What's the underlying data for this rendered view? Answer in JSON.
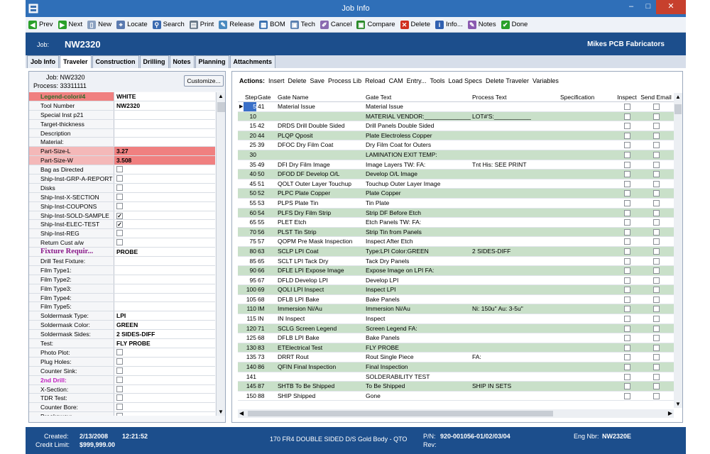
{
  "window": {
    "title": "Job Info",
    "minimize": "–",
    "maximize": "□",
    "close": "✕"
  },
  "toolbar": [
    {
      "label": "Prev",
      "icon": "prev-arrow-icon",
      "color": "#2aa02a",
      "glyph": "◀"
    },
    {
      "label": "Next",
      "icon": "next-arrow-icon",
      "color": "#2aa02a",
      "glyph": "▶"
    },
    {
      "label": "New",
      "icon": "new-document-icon",
      "color": "#8aa0c0",
      "glyph": "▯"
    },
    {
      "label": "Locate",
      "icon": "locate-icon",
      "color": "#5a7ab0",
      "glyph": "⌖"
    },
    {
      "label": "Search",
      "icon": "search-icon",
      "color": "#3a6ab0",
      "glyph": "⚲"
    },
    {
      "label": "Print",
      "icon": "printer-icon",
      "color": "#6a7a8a",
      "glyph": "▤"
    },
    {
      "label": "Release",
      "icon": "release-icon",
      "color": "#4a8ac0",
      "glyph": "✎"
    },
    {
      "label": "BOM",
      "icon": "bom-icon",
      "color": "#3a70b0",
      "glyph": "▦"
    },
    {
      "label": "Tech",
      "icon": "tech-icon",
      "color": "#5a80b0",
      "glyph": "▣"
    },
    {
      "label": "Cancel",
      "icon": "cancel-icon",
      "color": "#8a6ab0",
      "glyph": "✐"
    },
    {
      "label": "Compare",
      "icon": "compare-icon",
      "color": "#2a8a2a",
      "glyph": "▣"
    },
    {
      "label": "Delete",
      "icon": "delete-icon",
      "color": "#d03020",
      "glyph": "✕"
    },
    {
      "label": "Info...",
      "icon": "info-icon",
      "color": "#3060b0",
      "glyph": "i"
    },
    {
      "label": "Notes",
      "icon": "notes-icon",
      "color": "#8a5ab0",
      "glyph": "✎"
    },
    {
      "label": "Done",
      "icon": "done-check-icon",
      "color": "#2aa02a",
      "glyph": "✔"
    }
  ],
  "header": {
    "job_label": "Job:",
    "job_value": "NW2320",
    "company": "Mikes PCB Fabricators"
  },
  "tabs": [
    {
      "label": "Job Info",
      "active": false
    },
    {
      "label": "Traveler",
      "active": true
    },
    {
      "label": "Construction",
      "active": false
    },
    {
      "label": "Drilling",
      "active": false
    },
    {
      "label": "Notes",
      "active": false
    },
    {
      "label": "Planning",
      "active": false
    },
    {
      "label": "Attachments",
      "active": false
    }
  ],
  "left": {
    "job_line": "Job: NW2320",
    "process_line": "Process: 33311111",
    "customize": "Customize...",
    "rows": [
      {
        "key": "Legend-color#4",
        "value": "WHITE",
        "keyBg": "#f08080",
        "keyColor": "#2a6a2a",
        "bold": true
      },
      {
        "key": "Tool Number",
        "value": "NW2320"
      },
      {
        "key": "Special Inst p21",
        "value": ""
      },
      {
        "key": "Target-thickness",
        "value": ""
      },
      {
        "key": "Description",
        "value": ""
      },
      {
        "key": "Material:",
        "value": ""
      },
      {
        "key": "Part-Size-L",
        "value": "3.27",
        "keyBg": "#f4b8b8",
        "valBg": "#f08080"
      },
      {
        "key": "Part-Size-W",
        "value": "3.508",
        "keyBg": "#f4b8b8",
        "valBg": "#f08080"
      },
      {
        "key": "Bag as Directed",
        "check": false
      },
      {
        "key": "Ship-Inst-GRP-A-REPORT",
        "check": false
      },
      {
        "key": "Disks",
        "check": false
      },
      {
        "key": "Ship-Inst-X-SECTION",
        "check": false
      },
      {
        "key": "Ship-Inst-COUPONS",
        "check": false
      },
      {
        "key": "Ship-Inst-SOLD-SAMPLE",
        "check": true
      },
      {
        "key": "Ship-Inst-ELEC-TEST",
        "check": true
      },
      {
        "key": "Ship-Inst-REG",
        "check": false
      },
      {
        "key": "Return Cust a/w",
        "check": false
      },
      {
        "key": "Fixture Requir...",
        "value": "PROBE",
        "keyColor": "#8a1a8a",
        "big": true
      },
      {
        "key": "Drill Test Fixture:",
        "value": ""
      },
      {
        "key": "Film Type1:",
        "value": ""
      },
      {
        "key": "Film Type2:",
        "value": ""
      },
      {
        "key": "Film Type3:",
        "value": ""
      },
      {
        "key": "Film Type4:",
        "value": ""
      },
      {
        "key": "Film Type5:",
        "value": ""
      },
      {
        "key": "Soldermask Type:",
        "value": "LPI"
      },
      {
        "key": "Soldermask Color:",
        "value": "GREEN"
      },
      {
        "key": "Soldermask Sides:",
        "value": "2 SIDES-DIFF"
      },
      {
        "key": "Test:",
        "value": "FLY PROBE"
      },
      {
        "key": "Photo Plot:",
        "check": false
      },
      {
        "key": "Plug Holes:",
        "check": false
      },
      {
        "key": "Counter Sink:",
        "check": false
      },
      {
        "key": "2nd Drill:",
        "check": false,
        "keyColor": "#c020c0",
        "bold": true
      },
      {
        "key": "X-Section:",
        "check": false
      },
      {
        "key": "TDR Test:",
        "check": false
      },
      {
        "key": "Counter Bore:",
        "check": false
      },
      {
        "key": "Breakaway:",
        "check": false
      }
    ]
  },
  "actions": [
    "Actions:",
    "Insert",
    "Delete",
    "Save",
    "Process Lib",
    "Reload",
    "CAM",
    "Entry...",
    "Tools",
    "Load Specs",
    "Delete Traveler",
    "Variables"
  ],
  "table": {
    "headers": [
      "",
      "Step",
      "Gate",
      "Gate Name",
      "Gate Text",
      "Process Text",
      "Specification",
      "Inspect",
      "Send Email"
    ],
    "rows": [
      {
        "step": "5",
        "gate": "41",
        "name": "Material Issue",
        "text": "Material Issue",
        "proc": "",
        "spec": "",
        "g": false,
        "cur": true
      },
      {
        "step": "10",
        "gate": "",
        "name": "",
        "text": "MATERIAL VENDOR:_______________",
        "proc": "LOT#'S:___________",
        "spec": "",
        "g": true
      },
      {
        "step": "15",
        "gate": "42",
        "name": "DRDS Drill Double Sided",
        "text": "Drill Panels Double Sided",
        "proc": "",
        "spec": "",
        "g": false
      },
      {
        "step": "20",
        "gate": "44",
        "name": "PLQP Qposit",
        "text": "Plate Electroless Copper",
        "proc": "",
        "spec": "",
        "g": true
      },
      {
        "step": "25",
        "gate": "39",
        "name": "DFOC Dry Film Coat",
        "text": "Dry Film Coat for Outers",
        "proc": "",
        "spec": "",
        "g": false
      },
      {
        "step": "30",
        "gate": "",
        "name": "",
        "text": "LAMINATION EXIT TEMP:",
        "proc": "",
        "spec": "",
        "g": true
      },
      {
        "step": "35",
        "gate": "49",
        "name": "DFI Dry Film Image",
        "text": "Image Layers TW:      FA:",
        "proc": "Tnt His: SEE PRINT",
        "spec": "",
        "g": false
      },
      {
        "step": "40",
        "gate": "50",
        "name": "DFOD DF Develop O/L",
        "text": "Develop O/L Image",
        "proc": "",
        "spec": "",
        "g": true
      },
      {
        "step": "45",
        "gate": "51",
        "name": "QOLT Outer Layer Touchup",
        "text": "Touchup Outer Layer Image",
        "proc": "",
        "spec": "",
        "g": false
      },
      {
        "step": "50",
        "gate": "52",
        "name": "PLPC Plate Copper",
        "text": "Plate Copper",
        "proc": "",
        "spec": "",
        "g": true
      },
      {
        "step": "55",
        "gate": "53",
        "name": "PLPS Plate Tin",
        "text": "Tin Plate",
        "proc": "",
        "spec": "",
        "g": false
      },
      {
        "step": "60",
        "gate": "54",
        "name": "PLFS Dry Film Strip",
        "text": "Strip DF Before Etch",
        "proc": "",
        "spec": "",
        "g": true
      },
      {
        "step": "65",
        "gate": "55",
        "name": "PLET Etch",
        "text": "Etch Panels TW:      FA:",
        "proc": "",
        "spec": "",
        "g": false
      },
      {
        "step": "70",
        "gate": "56",
        "name": "PLST Tin Strip",
        "text": "Strip Tin from Panels",
        "proc": "",
        "spec": "",
        "g": true
      },
      {
        "step": "75",
        "gate": "57",
        "name": "QOPM Pre Mask Inspection",
        "text": "Inspect After Etch",
        "proc": "",
        "spec": "",
        "g": false
      },
      {
        "step": "80",
        "gate": "63",
        "name": "SCLP LPI Coat",
        "text": "Type:LPI Color:GREEN",
        "proc": "2 SIDES-DIFF",
        "spec": "",
        "g": true
      },
      {
        "step": "85",
        "gate": "65",
        "name": "SCLT LPI Tack Dry",
        "text": "Tack Dry Panels",
        "proc": "",
        "spec": "",
        "g": false
      },
      {
        "step": "90",
        "gate": "66",
        "name": "DFLE LPI Expose Image",
        "text": "Expose Image on LPI      FA:",
        "proc": "",
        "spec": "",
        "g": true
      },
      {
        "step": "95",
        "gate": "67",
        "name": "DFLD Develop LPI",
        "text": "Develop LPI",
        "proc": "",
        "spec": "",
        "g": false
      },
      {
        "step": "100",
        "gate": "69",
        "name": "QOLI LPI Inspect",
        "text": "Inspect LPI",
        "proc": "",
        "spec": "",
        "g": true
      },
      {
        "step": "105",
        "gate": "68",
        "name": "DFLB LPI Bake",
        "text": "Bake Panels",
        "proc": "",
        "spec": "",
        "g": false
      },
      {
        "step": "110",
        "gate": "IM",
        "name": "Immersion Ni/Au",
        "text": "Immersion Ni/Au",
        "proc": "Ni: 150u\"   Au: 3-5u\"",
        "spec": "",
        "g": true
      },
      {
        "step": "115",
        "gate": "IN",
        "name": "IN Inspect",
        "text": "Inspect",
        "proc": "",
        "spec": "",
        "g": false
      },
      {
        "step": "120",
        "gate": "71",
        "name": "SCLG Screen Legend",
        "text": "Screen Legend          FA:",
        "proc": "",
        "spec": "",
        "g": true
      },
      {
        "step": "125",
        "gate": "68",
        "name": "DFLB LPI Bake",
        "text": "Bake Panels",
        "proc": "",
        "spec": "",
        "g": false
      },
      {
        "step": "130",
        "gate": "83",
        "name": "ETElectrical Test",
        "text": "FLY PROBE",
        "proc": "",
        "spec": "",
        "g": true
      },
      {
        "step": "135",
        "gate": "73",
        "name": "DRRT Rout",
        "text": "Rout Single Piece",
        "proc": "FA:",
        "spec": "",
        "g": false
      },
      {
        "step": "140",
        "gate": "86",
        "name": "QFIN Final Inspection",
        "text": "Final Inspection",
        "proc": "",
        "spec": "",
        "g": true
      },
      {
        "step": "141",
        "gate": "",
        "name": "",
        "text": "SOLDERABILITY TEST",
        "proc": "",
        "spec": "",
        "g": false
      },
      {
        "step": "145",
        "gate": "87",
        "name": "SHTB To Be Shipped",
        "text": "To Be Shipped",
        "proc": "SHIP IN SETS",
        "spec": "",
        "g": true
      },
      {
        "step": "150",
        "gate": "88",
        "name": "SHIP Shipped",
        "text": "Gone",
        "proc": "",
        "spec": "",
        "g": false
      }
    ]
  },
  "footer": {
    "created_label": "Created:",
    "created_date": "2/13/2008",
    "created_time": "12:21:52",
    "credit_label": "Credit Limit:",
    "credit_value": "$999,999.00",
    "description": "170 FR4 DOUBLE SIDED D/S Gold Body - QTO",
    "pn_label": "P/N:",
    "pn_value": "920-001056-01/02/03/04",
    "rev_label": "Rev:",
    "eng_label": "Eng Nbr:",
    "eng_value": "NW2320E"
  }
}
